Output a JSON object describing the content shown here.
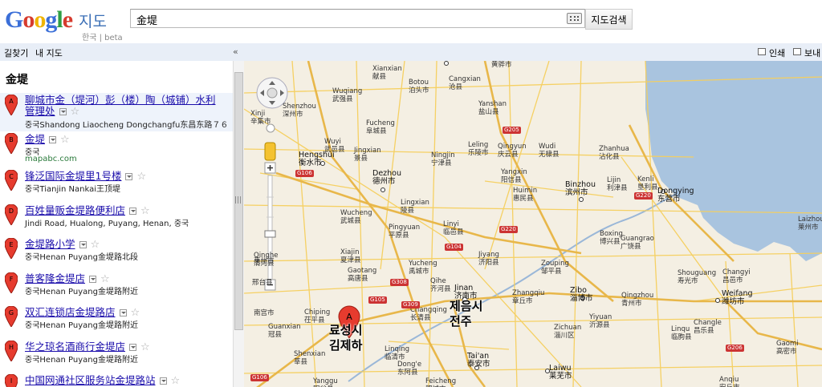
{
  "header": {
    "logo_text": "Google",
    "logo_product": "지도",
    "logo_sub": "한국 | beta",
    "search_value": "金堤",
    "search_button": "지도검색"
  },
  "nav": {
    "directions": "길찾기",
    "my_maps": "내 지도",
    "collapse": "«"
  },
  "map_tools": {
    "print": "인쇄",
    "send": "보내"
  },
  "query_title": "金堤",
  "results": [
    {
      "letter": "A",
      "title": "聊城市金（堤河）彭（楼）陶（城铺）水利",
      "title2": "管理处",
      "addr": "중국Shandong Liaocheng Dongchangfu东昌东路７６"
    },
    {
      "letter": "B",
      "title": "金堤",
      "addr": "중국",
      "url": "mapabc.com"
    },
    {
      "letter": "C",
      "title": "锋泛国际金堤里1号楼",
      "addr": "중국Tianjin Nankai王顶堤"
    },
    {
      "letter": "D",
      "title": "百姓量贩金堤路便利店",
      "addr": "Jindi Road, Hualong, Puyang, Henan, 중국"
    },
    {
      "letter": "E",
      "title": "金堤路小学",
      "addr": "중국Henan Puyang金堤路北段"
    },
    {
      "letter": "F",
      "title": "普客隆金堤店",
      "addr": "중국Henan Puyang金堤路附近"
    },
    {
      "letter": "G",
      "title": "双汇连锁店金堤路店",
      "addr": "중국Henan Puyang金堤路附近"
    },
    {
      "letter": "H",
      "title": "华之琼名酒商行金堤店",
      "addr": "중국Henan Puyang金堤路附近"
    },
    {
      "letter": "I",
      "title": "中国网通社区服务站金堤路站"
    }
  ],
  "map": {
    "cities": [
      {
        "name": "Xianxian",
        "local": "献县"
      },
      {
        "name": "Botou",
        "local": "泊头市"
      },
      {
        "name": "Cangxian",
        "local": "沧县"
      },
      {
        "name": "",
        "local": "黄骅市"
      },
      {
        "name": "Wuqiang",
        "local": "武强县"
      },
      {
        "name": "Fucheng",
        "local": "阜城县"
      },
      {
        "name": "Yanshan",
        "local": "盐山县"
      },
      {
        "name": "Shenzhou",
        "local": "深州市"
      },
      {
        "name": "Xinji",
        "local": "辛集市"
      },
      {
        "name": "Wuyi",
        "local": "武邑县"
      },
      {
        "name": "Jingxian",
        "local": "景县"
      },
      {
        "name": "Ningjin",
        "local": "宁津县"
      },
      {
        "name": "Leling",
        "local": "乐陵市"
      },
      {
        "name": "Qingyun",
        "local": "庆云县"
      },
      {
        "name": "Wudi",
        "local": "无棣县"
      },
      {
        "name": "Zhanhua",
        "local": "沾化县"
      },
      {
        "name": "Hengshui",
        "local": "衡水市"
      },
      {
        "name": "Dezhou",
        "local": "德州市"
      },
      {
        "name": "Yangxin",
        "local": "阳信县"
      },
      {
        "name": "Binzhou",
        "local": "滨州市"
      },
      {
        "name": "Lijin",
        "local": "利津县"
      },
      {
        "name": "Kenli",
        "local": "垦利县"
      },
      {
        "name": "Dongying",
        "local": "东营市"
      },
      {
        "name": "Lingxian",
        "local": "陵县"
      },
      {
        "name": "Huimin",
        "local": "惠民县"
      },
      {
        "name": "Wucheng",
        "local": "武城县"
      },
      {
        "name": "Linyi",
        "local": "临邑县"
      },
      {
        "name": "Pingyuan",
        "local": "平原县"
      },
      {
        "name": "Boxing",
        "local": "博兴县"
      },
      {
        "name": "Guangrao",
        "local": "广饶县"
      },
      {
        "name": "Laizhou",
        "local": "莱州市"
      },
      {
        "name": "Qinghe",
        "local": "清河县"
      },
      {
        "name": "Xiajin",
        "local": "夏津县"
      },
      {
        "name": "Jiyang",
        "local": "济阳县"
      },
      {
        "name": "Zouping",
        "local": "邹平县"
      },
      {
        "name": "Gaotang",
        "local": "高唐县"
      },
      {
        "name": "Yucheng",
        "local": "禹城市"
      },
      {
        "name": "Qihe",
        "local": "齐河县"
      },
      {
        "name": "Jinan",
        "local": "济南市"
      },
      {
        "name": "Zhangqiu",
        "local": "章丘市"
      },
      {
        "name": "Zibo",
        "local": "淄博市"
      },
      {
        "name": "Qingzhou",
        "local": "青州市"
      },
      {
        "name": "Shouguang",
        "local": "寿光市"
      },
      {
        "name": "Changyi",
        "local": "昌邑市"
      },
      {
        "name": "Weifang",
        "local": "潍坊市"
      },
      {
        "name": "Guanxian",
        "local": "冠县"
      },
      {
        "name": "Chiping",
        "local": "茌平县"
      },
      {
        "name": "Changqing",
        "local": "长清县"
      },
      {
        "name": "Zichuan",
        "local": "淄川区"
      },
      {
        "name": "Yiyuan",
        "local": "沂源县"
      },
      {
        "name": "Linqu",
        "local": "临朐县"
      },
      {
        "name": "Changle",
        "local": "昌乐县"
      },
      {
        "name": "Shenxian",
        "local": "莘县"
      },
      {
        "name": "Dong'e",
        "local": "东阿县"
      },
      {
        "name": "Tai'an",
        "local": "泰安市"
      },
      {
        "name": "Laiwu",
        "local": "莱芜市"
      },
      {
        "name": "Gaomi",
        "local": "高密市"
      },
      {
        "name": "Yanggu",
        "local": "阳谷县"
      },
      {
        "name": "Feicheng",
        "local": "肥城市"
      },
      {
        "name": "Anqiu",
        "local": "安丘市"
      },
      {
        "name": "",
        "local": "邢台县"
      },
      {
        "name": "",
        "local": "南宫市"
      },
      {
        "name": "Linqing",
        "local": "临清市"
      },
      {
        "name": "",
        "local": "莱州市"
      }
    ],
    "highways": [
      "G205",
      "G106",
      "G220",
      "G220",
      "G104",
      "G308",
      "G105",
      "G309",
      "G106",
      "G206"
    ],
    "korean_labels": [
      "료성시",
      "김제하",
      "제음시",
      "전주"
    ],
    "marker_letter": "A",
    "colors": {
      "land": "#f4efe3",
      "water": "#a9c4df",
      "road": "#f6cf5d",
      "highway": "#e8b74a",
      "marker": "#e63b2e"
    }
  }
}
